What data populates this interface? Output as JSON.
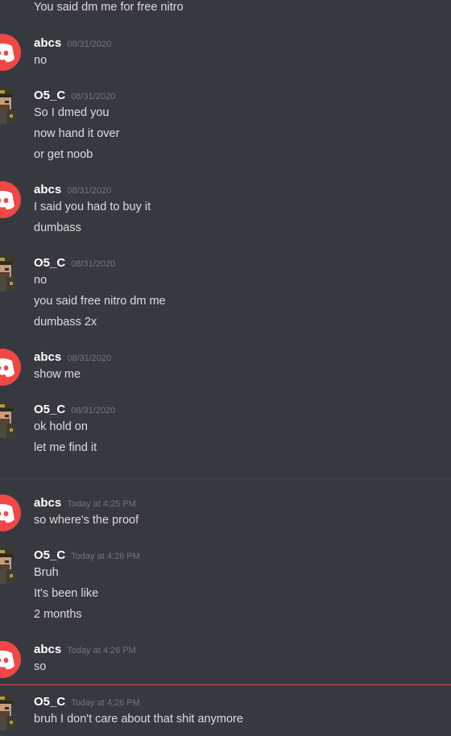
{
  "colors": {
    "background": "#36393f",
    "username": "#ffffff",
    "message_text": "#dcddde",
    "timestamp": "#72767d",
    "discord_avatar": "#f04747",
    "new_messages_divider": "#f04747",
    "date_divider": "#42454a"
  },
  "messages": [
    {
      "text": "You said dm me for free nitro"
    },
    {
      "author": "abcs",
      "timestamp": "08/31/2020",
      "avatar": "discord-default-avatar-icon",
      "text": "no"
    },
    {
      "author": "O5_C",
      "timestamp": "08/31/2020",
      "avatar": "soldier-avatar-icon",
      "text": "So I dmed you"
    },
    {
      "text": "now hand it over"
    },
    {
      "text": "or get noob"
    },
    {
      "author": "abcs",
      "timestamp": "08/31/2020",
      "avatar": "discord-default-avatar-icon",
      "text": "I said you had to buy it"
    },
    {
      "text": "dumbass"
    },
    {
      "author": "O5_C",
      "timestamp": "08/31/2020",
      "avatar": "soldier-avatar-icon",
      "text": "no"
    },
    {
      "text": "you said free nitro dm me"
    },
    {
      "text": "dumbass 2x"
    },
    {
      "author": "abcs",
      "timestamp": "08/31/2020",
      "avatar": "discord-default-avatar-icon",
      "text": "show me"
    },
    {
      "author": "O5_C",
      "timestamp": "08/31/2020",
      "avatar": "soldier-avatar-icon",
      "text": "ok hold on"
    },
    {
      "text": "let me find it"
    },
    {
      "author": "abcs",
      "timestamp": "Today at 4:25 PM",
      "avatar": "discord-default-avatar-icon",
      "text": "so where's the proof"
    },
    {
      "author": "O5_C",
      "timestamp": "Today at 4:26 PM",
      "avatar": "soldier-avatar-icon",
      "text": "Bruh"
    },
    {
      "text": "It's been like"
    },
    {
      "text": "2 months"
    },
    {
      "author": "abcs",
      "timestamp": "Today at 4:26 PM",
      "avatar": "discord-default-avatar-icon",
      "text": "so"
    },
    {
      "author": "O5_C",
      "timestamp": "Today at 4:26 PM",
      "avatar": "soldier-avatar-icon",
      "text": "bruh I don't care about that shit anymore"
    }
  ]
}
